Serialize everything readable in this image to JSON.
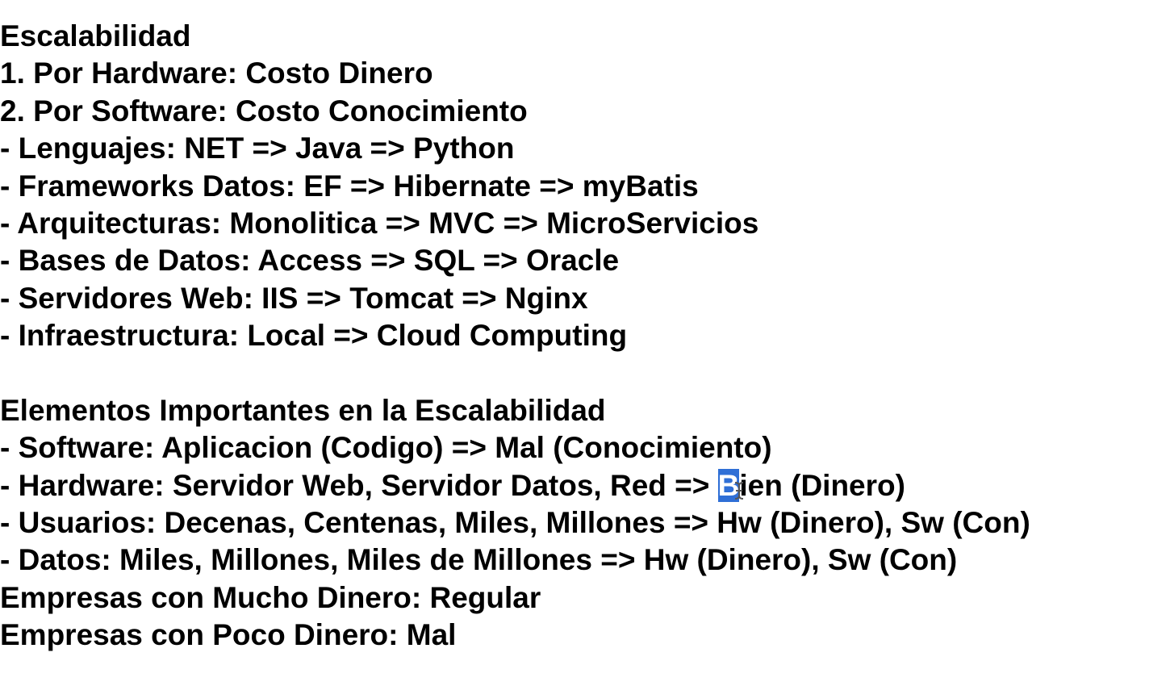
{
  "section1": {
    "heading": "Escalabilidad",
    "lines": [
      "1. Por Hardware: Costo Dinero",
      "2. Por Software: Costo Conocimiento",
      "- Lenguajes: NET => Java => Python",
      "- Frameworks Datos: EF => Hibernate => myBatis",
      "- Arquitecturas: Monolitica => MVC => MicroServicios",
      "- Bases de Datos: Access => SQL => Oracle",
      "- Servidores Web: IIS => Tomcat => Nginx",
      "- Infraestructura: Local => Cloud Computing"
    ]
  },
  "section2": {
    "heading": "Elementos Importantes en la Escalabilidad",
    "software_line": "- Software: Aplicacion (Codigo) => Mal (Conocimiento)",
    "hardware_line": {
      "before": "- Hardware: Servidor Web, Servidor Datos, Red => ",
      "selected": "B",
      "after": "ien (Dinero)"
    },
    "usuarios_line": "- Usuarios: Decenas, Centenas, Miles, Millones => Hw (Dinero), Sw (Con)",
    "datos_line": "- Datos: Miles, Millones, Miles de Millones => Hw (Dinero), Sw (Con)",
    "empresas_mucho": "Empresas con Mucho Dinero: Regular",
    "empresas_poco": "Empresas con Poco Dinero: Mal"
  },
  "colors": {
    "text": "#000000",
    "selection": "#2f6fd6",
    "background": "#ffffff"
  },
  "icons": {
    "cursor": "text-cursor-icon"
  }
}
